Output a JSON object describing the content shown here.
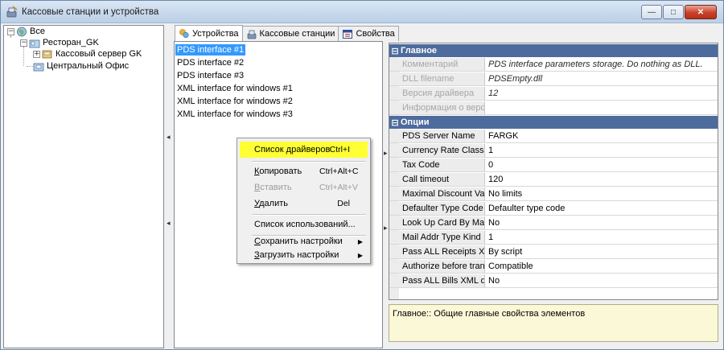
{
  "window": {
    "title": "Кассовые станции и устройства",
    "buttons": {
      "minimize": "—",
      "maximize": "□",
      "close": "✕"
    }
  },
  "tree": {
    "root": "Все",
    "nodes": [
      {
        "label": "Ресторан_GK",
        "icon": "restaurant-icon"
      },
      {
        "label": "Кассовый сервер GK",
        "icon": "server-icon"
      },
      {
        "label": "Центральный Офис",
        "icon": "office-icon"
      }
    ]
  },
  "tabs": [
    {
      "label": "Устройства",
      "icon": "devices-icon",
      "active": true
    },
    {
      "label": "Кассовые станции",
      "icon": "cash-station-icon",
      "active": false
    },
    {
      "label": "Свойства",
      "icon": "properties-icon",
      "active": false
    }
  ],
  "devices": [
    "PDS interface #1",
    "PDS interface #2",
    "PDS interface #3",
    "XML interface for windows #1",
    "XML interface for windows #2",
    "XML interface for windows #3"
  ],
  "properties": {
    "main_category": "Главное",
    "main": [
      {
        "name": "Комментарий",
        "value": "PDS interface parameters storage. Do nothing as DLL."
      },
      {
        "name": "DLL filename",
        "value": "PDSEmpty.dll"
      },
      {
        "name": "Версия драйвера",
        "value": "12"
      },
      {
        "name": "Информация о верси",
        "value": ""
      }
    ],
    "options_category": "Опции",
    "options": [
      {
        "name": "PDS Server Name",
        "value": "FARGK"
      },
      {
        "name": "Currency Rate Class Cc",
        "value": "1"
      },
      {
        "name": "Tax Code",
        "value": "0"
      },
      {
        "name": "Call timeout",
        "value": "120"
      },
      {
        "name": "Maximal Discount Value",
        "value": "No limits"
      },
      {
        "name": "Defaulter Type Code as",
        "value": "Defaulter type code"
      },
      {
        "name": "Look Up Card By Mail A",
        "value": "No"
      },
      {
        "name": "Mail Addr Type Kind",
        "value": "1"
      },
      {
        "name": "Pass ALL Receipts XM",
        "value": "By script"
      },
      {
        "name": "Authorize before transa",
        "value": "Compatible"
      },
      {
        "name": "Pass ALL Bills XML dat",
        "value": "No"
      }
    ]
  },
  "description": "Главное:: Общие главные свойства элементов",
  "context_menu": {
    "driver_list": {
      "label": "Список драйверов",
      "shortcut": "Ctrl+I"
    },
    "copy": {
      "label_first": "К",
      "label_rest": "опировать",
      "shortcut": "Ctrl+Alt+C"
    },
    "paste": {
      "label_first": "В",
      "label_rest": "ставить",
      "shortcut": "Ctrl+Alt+V"
    },
    "delete": {
      "label_first": "У",
      "label_rest": "далить",
      "shortcut": "Del"
    },
    "usage_list": {
      "label": "Список использований..."
    },
    "save_settings": {
      "label_first": "С",
      "label_rest": "охранить настройки"
    },
    "load_settings": {
      "label_first": "З",
      "label_rest": "агрузить настройки"
    }
  },
  "colors": {
    "selection": "#3399ff",
    "category_header": "#4d6b9c",
    "menu_highlight": "#ffff33",
    "description_bg": "#fbf8d8"
  }
}
